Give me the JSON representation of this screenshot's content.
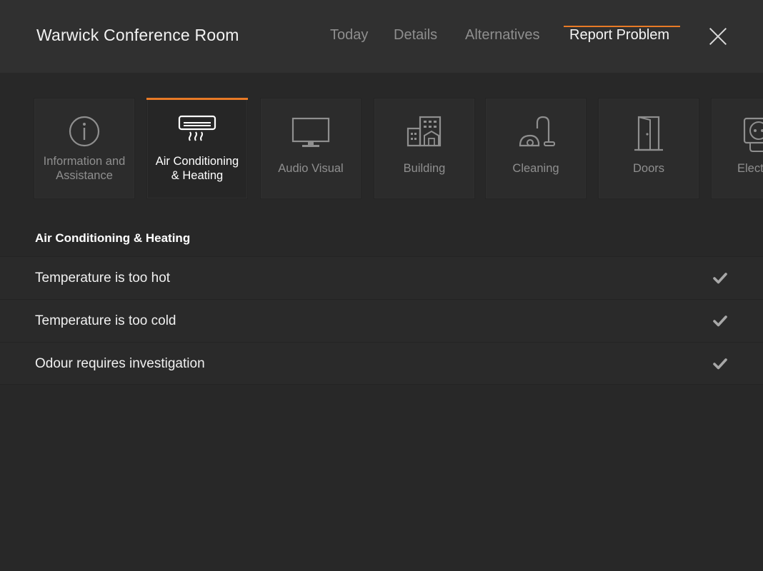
{
  "header": {
    "room_title": "Warwick Conference Room",
    "tabs": [
      {
        "label": "Today",
        "active": false
      },
      {
        "label": "Details",
        "active": false
      },
      {
        "label": "Alternatives",
        "active": false
      },
      {
        "label": "Report Problem",
        "active": true
      }
    ],
    "close_icon": "close-icon"
  },
  "categories": [
    {
      "label": "Information and Assistance",
      "icon": "info-icon",
      "active": false
    },
    {
      "label": "Air Conditioning & Heating",
      "icon": "air-conditioner-icon",
      "active": true
    },
    {
      "label": "Audio Visual",
      "icon": "monitor-icon",
      "active": false
    },
    {
      "label": "Building",
      "icon": "building-icon",
      "active": false
    },
    {
      "label": "Cleaning",
      "icon": "vacuum-cleaner-icon",
      "active": false
    },
    {
      "label": "Doors",
      "icon": "door-icon",
      "active": false
    },
    {
      "label": "Elect",
      "icon": "power-socket-icon",
      "active": false
    }
  ],
  "section": {
    "title": "Air Conditioning & Heating",
    "issues": [
      {
        "label": "Temperature is too hot",
        "icon": "checkmark-icon"
      },
      {
        "label": "Temperature is too cold",
        "icon": "checkmark-icon"
      },
      {
        "label": "Odour requires investigation",
        "icon": "checkmark-icon"
      }
    ]
  },
  "colors": {
    "accent": "#e87a26",
    "background": "#282828",
    "header_background": "#303030"
  }
}
